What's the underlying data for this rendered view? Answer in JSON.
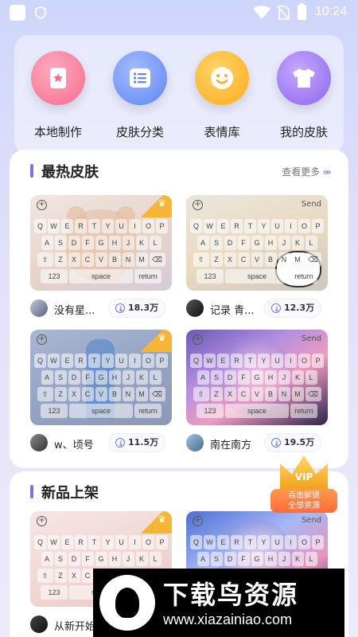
{
  "status_bar": {
    "time": "10:24"
  },
  "categories": [
    {
      "label": "本地制作",
      "icon": "card-icon",
      "color": "#f56d8e"
    },
    {
      "label": "皮肤分类",
      "icon": "list-icon",
      "color": "#5d86f3"
    },
    {
      "label": "表情库",
      "icon": "smiley-icon",
      "color": "#ffaa1c"
    },
    {
      "label": "我的皮肤",
      "icon": "tshirt-icon",
      "color": "#8d66ec"
    }
  ],
  "hot": {
    "title": "最热皮肤",
    "more": "查看更多",
    "skins": [
      {
        "name": "没有星...",
        "downloads": "18.3万"
      },
      {
        "name": "记录 青...",
        "downloads": "12.3万"
      },
      {
        "name": "w、顷号",
        "downloads": "11.5万"
      },
      {
        "name": "南在南方",
        "downloads": "19.5万"
      }
    ]
  },
  "new_arrivals": {
    "title": "新品上架",
    "skins": [
      {
        "name": "从新开始"
      },
      {
        "name": ""
      }
    ]
  },
  "keyboard": {
    "row1": [
      "Q",
      "W",
      "E",
      "R",
      "T",
      "Y",
      "U",
      "I",
      "O",
      "P"
    ],
    "row2": [
      "A",
      "S",
      "D",
      "F",
      "G",
      "H",
      "J",
      "K",
      "L"
    ],
    "row3": [
      "⇧",
      "Z",
      "X",
      "C",
      "V",
      "B",
      "N",
      "M",
      "⌫"
    ],
    "row4": [
      "123",
      "space",
      "return"
    ],
    "send": "Send",
    "plus": "+"
  },
  "vip": {
    "badge": "VIP",
    "line1": "点击解锁",
    "line2": "全部资源"
  },
  "watermark": {
    "title": "下载鸟资源",
    "url": "www.xiazainiao.com"
  },
  "accent": "#7b6ef6"
}
